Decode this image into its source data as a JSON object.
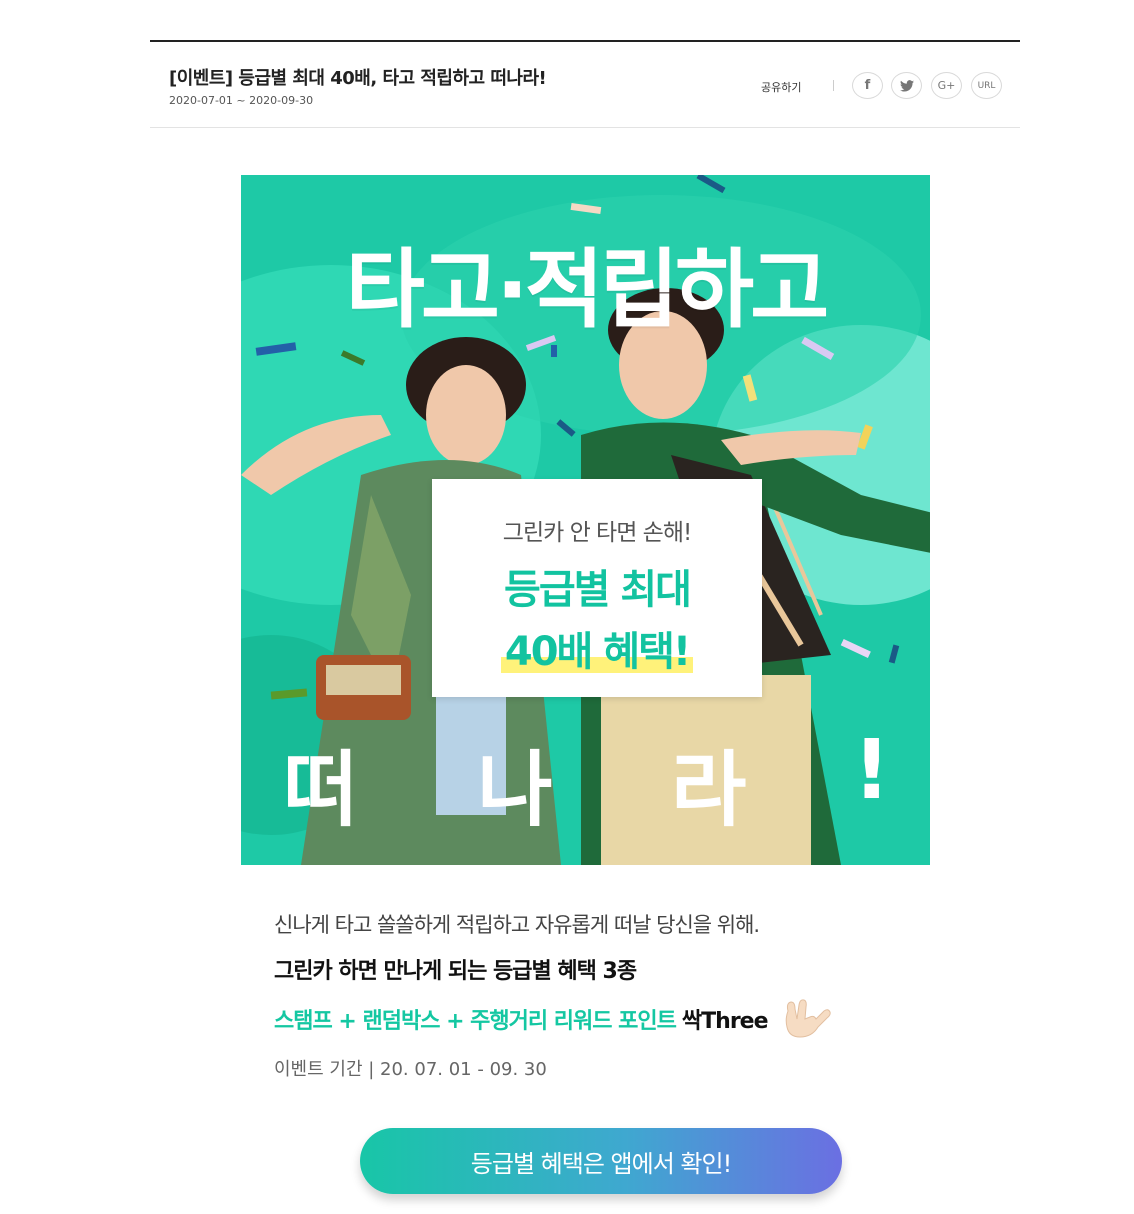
{
  "header": {
    "title": "[이벤트] 등급별 최대 40배, 타고 적립하고 떠나라!",
    "date": "2020-07-01 ~ 2020-09-30",
    "share_label": "공유하기",
    "share_buttons": [
      {
        "label": "f",
        "icon": "facebook-icon"
      },
      {
        "label": "🐦",
        "icon": "twitter-icon"
      },
      {
        "label": "G+",
        "icon": "google-plus-icon"
      },
      {
        "label": "URL",
        "icon": "link-icon"
      }
    ]
  },
  "banner": {
    "headline": "타고·적립하고",
    "bottom_chars": [
      "떠",
      "나",
      "라",
      "!"
    ],
    "card": {
      "line1": "그린카 안 타면 손해!",
      "line2": "등급별 최대",
      "line3": "40배 혜택!"
    },
    "colors": {
      "background": "#1ec9a6",
      "accent": "#12c3a0",
      "highlight": "#fff27a"
    }
  },
  "description": {
    "line1": "신나게 타고 쏠쏠하게 적립하고 자유롭게 떠날 당신을 위해.",
    "line2": "그린카 하면 만나게 되는 등급별 혜택 3종",
    "line3_green": "스탬프 + 랜덤박스 + 주행거리 리워드 포인트",
    "line3_dark": "싹Three",
    "period": "이벤트 기간 | 20. 07. 01 - 09. 30"
  },
  "cta": {
    "label": "등급별 혜택은 앱에서 확인!"
  }
}
